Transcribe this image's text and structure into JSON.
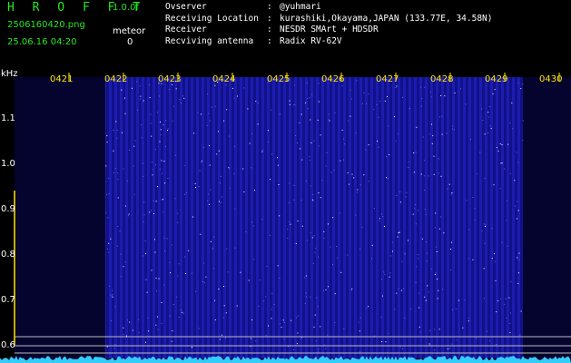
{
  "app": {
    "title": "H R O F F T",
    "version": "1.0.0f",
    "filename": "2506160420.png",
    "datetime": "25.06.16 04:20",
    "meteor_label": "meteor",
    "meteor_count": "0"
  },
  "info": [
    {
      "key": "Ovserver",
      "value": "@yuhmari"
    },
    {
      "key": "Receiving Location",
      "value": "kurashiki,Okayama,JAPAN (133.77E, 34.58N)"
    },
    {
      "key": "Receiver",
      "value": "NESDR SMArt + HDSDR"
    },
    {
      "key": "Recviving antenna",
      "value": "Radix RV-62V"
    }
  ],
  "spectrogram": {
    "y_unit": "kHz",
    "y_ticks": [
      "1.1",
      "1.0",
      "0.9",
      "0.8",
      "0.7",
      "0.6"
    ],
    "x_ticks": [
      "0421",
      "0422",
      "0423",
      "0424",
      "0425",
      "0426",
      "0427",
      "0428",
      "0429",
      "0430"
    ],
    "colors": {
      "background": "#000000",
      "signal": "#1a1aa8",
      "noise_strip": "#33ccff",
      "time_labels": "#ffe600",
      "header_text": "#26e626"
    }
  }
}
